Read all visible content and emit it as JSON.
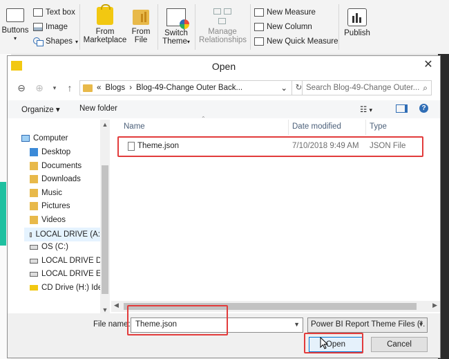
{
  "ribbon": {
    "buttons_label": "Buttons",
    "text_box": "Text box",
    "image": "Image",
    "shapes": "Shapes",
    "from_marketplace_1": "From",
    "from_marketplace_2": "Marketplace",
    "from_file_1": "From",
    "from_file_2": "File",
    "switch_theme_1": "Switch",
    "switch_theme_2": "Theme",
    "manage_rel_1": "Manage",
    "manage_rel_2": "Relationships",
    "new_measure": "New Measure",
    "new_column": "New Column",
    "new_quick_measure": "New Quick Measure",
    "publish": "Publish"
  },
  "dialog": {
    "title": "Open",
    "close_glyph": "✕",
    "breadcrumb": {
      "prefix": "«",
      "part1": "Blogs",
      "sep": "›",
      "part2": "Blog-49-Change Outer Back...",
      "dropdown": "⌄"
    },
    "search_placeholder": "Search Blog-49-Change Outer...",
    "toolbar": {
      "organize": "Organize ▾",
      "new_folder": "New folder"
    },
    "nav": [
      {
        "label": "Computer"
      },
      {
        "label": "Desktop"
      },
      {
        "label": "Documents"
      },
      {
        "label": "Downloads"
      },
      {
        "label": "Music"
      },
      {
        "label": "Pictures"
      },
      {
        "label": "Videos"
      },
      {
        "label": "LOCAL DRIVE (A:"
      },
      {
        "label": "OS (C:)"
      },
      {
        "label": "LOCAL DRIVE D ("
      },
      {
        "label": "LOCAL DRIVE E (I"
      },
      {
        "label": "CD Drive (H:) Ide"
      }
    ],
    "columns": {
      "name": "Name",
      "date": "Date modified",
      "type": "Type"
    },
    "files": [
      {
        "name": "Theme.json",
        "date": "7/10/2018 9:49 AM",
        "type": "JSON File"
      }
    ],
    "file_name_label": "File name:",
    "file_name_value": "Theme.json",
    "file_type_value": "Power BI Report Theme Files (*.",
    "open_label": "Open",
    "cancel_label": "Cancel"
  },
  "colors": {
    "highlight": "#e23b3b",
    "accent": "#0078d7",
    "pbi_yellow": "#f2c811"
  }
}
